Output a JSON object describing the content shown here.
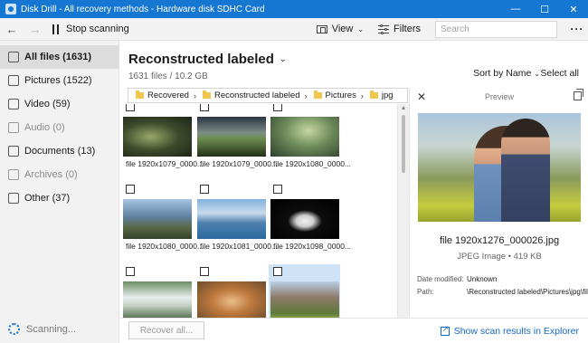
{
  "window": {
    "title": "Disk Drill - All recovery methods - Hardware disk SDHC Card"
  },
  "toolbar": {
    "stop_label": "Stop scanning",
    "view_label": "View",
    "filters_label": "Filters",
    "search_placeholder": "Search"
  },
  "sidebar": {
    "items": [
      {
        "label": "All files (1631)",
        "icon": "all-files-icon"
      },
      {
        "label": "Pictures (1522)",
        "icon": "pictures-icon"
      },
      {
        "label": "Video (59)",
        "icon": "video-icon"
      },
      {
        "label": "Audio (0)",
        "icon": "audio-icon"
      },
      {
        "label": "Documents (13)",
        "icon": "documents-icon"
      },
      {
        "label": "Archives (0)",
        "icon": "archives-icon"
      },
      {
        "label": "Other (37)",
        "icon": "other-icon"
      }
    ],
    "scanning_label": "Scanning..."
  },
  "main": {
    "title": "Reconstructed labeled",
    "subtitle": "1631 files / 10.2 GB",
    "sort_label": "Sort by Name",
    "select_all_label": "Select all",
    "breadcrumb": [
      "Recovered",
      "Reconstructed labeled",
      "Pictures",
      "jpg"
    ],
    "files": [
      "file 1920x1079_0000...",
      "file 1920x1079_0000...",
      "file 1920x1080_0000...",
      "file 1920x1080_0000...",
      "file 1920x1081_0000...",
      "file 1920x1098_0000...",
      "",
      "",
      ""
    ],
    "recover_label": "Recover all...",
    "explorer_link": "Show scan results in Explorer"
  },
  "preview": {
    "title": "Preview",
    "filename": "file 1920x1276_000026.jpg",
    "meta": "JPEG Image • 419 KB",
    "date_label": "Date modified:",
    "date_value": "Unknown",
    "path_label": "Path:",
    "path_value": "\\Reconstructed labeled\\Pictures\\jpg\\file"
  },
  "colors": {
    "accent": "#1577d1",
    "link": "#1567c1",
    "selection": "#cfe3f6"
  }
}
